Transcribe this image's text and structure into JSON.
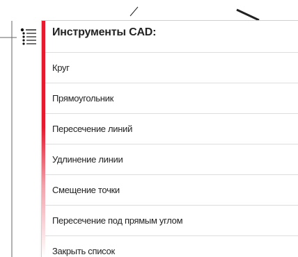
{
  "panel": {
    "title": "Инструменты CAD:",
    "accent_color": "#e6192f",
    "items": [
      {
        "label": "Круг"
      },
      {
        "label": "Прямоугольник"
      },
      {
        "label": "Пересечение линий"
      },
      {
        "label": "Удлинение линии"
      },
      {
        "label": "Смещение точки"
      },
      {
        "label": "Пересечение под прямым углом"
      },
      {
        "label": "Закрыть список"
      }
    ]
  },
  "toggle": {
    "icon": "list-icon"
  }
}
